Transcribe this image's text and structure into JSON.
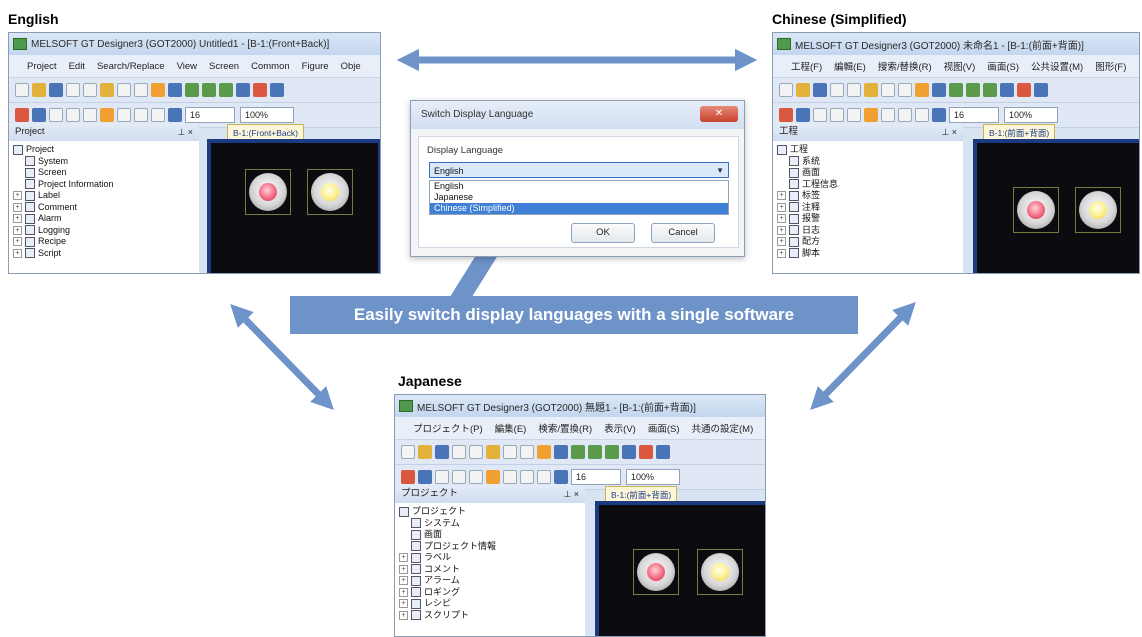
{
  "english": {
    "label": "English",
    "title": "MELSOFT GT Designer3 (GOT2000) Untitled1 - [B-1:(Front+Back)]",
    "menus": [
      "Project",
      "Edit",
      "Search/Replace",
      "View",
      "Screen",
      "Common",
      "Figure",
      "Obje"
    ],
    "font_size": "16",
    "zoom": "100%",
    "pane_title": "Project",
    "tab": "B-1:(Front+Back)",
    "tree": [
      "Project",
      "System",
      "Screen",
      "Project Information",
      "Label",
      "Comment",
      "Alarm",
      "Logging",
      "Recipe",
      "Script"
    ]
  },
  "chinese": {
    "label": "Chinese (Simplified)",
    "title": "MELSOFT GT Designer3 (GOT2000) 未命名1 - [B-1:(前面+背面)]",
    "menus": [
      "工程(F)",
      "編輯(E)",
      "搜索/替换(R)",
      "视图(V)",
      "画面(S)",
      "公共设置(M)",
      "图形(F)"
    ],
    "font_size": "16",
    "zoom": "100%",
    "pane_title": "工程",
    "tab": "B-1:(前面+背面)",
    "tree": [
      "工程",
      "系统",
      "画面",
      "工程信息",
      "标签",
      "注释",
      "报警",
      "日志",
      "配方",
      "脚本"
    ]
  },
  "japanese": {
    "label": "Japanese",
    "title": "MELSOFT GT Designer3 (GOT2000) 無題1 - [B-1:(前面+背面)]",
    "menus": [
      "プロジェクト(P)",
      "編集(E)",
      "検索/置換(R)",
      "表示(V)",
      "画面(S)",
      "共通の設定(M)"
    ],
    "font_size": "16",
    "zoom": "100%",
    "pane_title": "プロジェクト",
    "tab": "B-1:(前面+背面)",
    "tree": [
      "プロジェクト",
      "システム",
      "画面",
      "プロジェクト情報",
      "ラベル",
      "コメント",
      "アラーム",
      "ロギング",
      "レシピ",
      "スクリプト"
    ]
  },
  "dialog": {
    "title": "Switch Display Language",
    "close": "Close",
    "field_label": "Display Language",
    "selected": "English",
    "options": [
      "English",
      "Japanese",
      "Chinese (Simplified)"
    ],
    "ok": "OK",
    "cancel": "Cancel"
  },
  "callout": "Easily switch display languages with a single software",
  "colors": {
    "arrow": "#6d93c8",
    "callout_bg": "#6d93c8",
    "canvas_border": "#1c3a80"
  },
  "icons": [
    "double-arrow-icon",
    "lamp-red",
    "lamp-yellow"
  ]
}
